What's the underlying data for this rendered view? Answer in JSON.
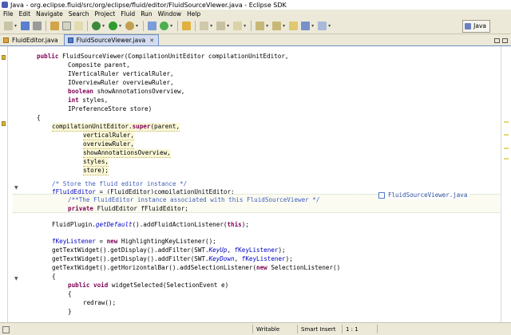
{
  "window": {
    "title": "Java - org.eclipse.fluid/src/org/eclipse/fluid/editor/FluidSourceViewer.java - Eclipse SDK"
  },
  "menu": [
    "File",
    "Edit",
    "Navigate",
    "Search",
    "Project",
    "Fluid",
    "Run",
    "Window",
    "Help"
  ],
  "toolbar": {
    "perspective_label": "Java",
    "icons": [
      "new-icon",
      "save-icon",
      "print-icon",
      "open-type-icon",
      "build-icon",
      "debug-icon",
      "run-icon",
      "new-class-icon",
      "search-icon",
      "next-annotation-icon",
      "prev-annotation-icon",
      "back-icon",
      "forward-icon"
    ]
  },
  "tabs": [
    {
      "label": "FluidEditor.java",
      "active": false
    },
    {
      "label": "FluidSourceViewer.java",
      "active": true
    }
  ],
  "code": {
    "l1": [
      "public",
      " FluidSourceViewer(CompilationUnitEditor compilationUnitEditor,"
    ],
    "l2": "Composite parent,",
    "l3": "IVerticalRuler verticalRuler,",
    "l4": "IOverviewRuler overviewRuler,",
    "l5": [
      "boolean",
      " showAnnotationsOverview,"
    ],
    "l6": [
      "int",
      " styles,"
    ],
    "l7": "IPreferenceStore store)",
    "l8": "{",
    "l9": [
      "compilationUnitEditor.",
      "super",
      "(parent,"
    ],
    "l10": "verticalRuler,",
    "l11": "overviewRuler,",
    "l12": "showAnnotationsOverview,",
    "l13": "styles,",
    "l14": "store);",
    "l15": "/* Store the fluid editor instance */",
    "l16": [
      "fFluidEditor",
      " = (FluidEditor)compilationUnitEditor;"
    ],
    "l17": "/**The FluidEditor instance associated with this FluidSourceViewer */",
    "l18": [
      "private",
      " FluidEditor fFluidEditor;"
    ],
    "l19": [
      "FluidPlugin.",
      "getDefault",
      "().addFluidActionListener(",
      "this",
      ");"
    ],
    "l20": [
      "fKeyListener",
      " = ",
      "new",
      " HighlightingKeyListener();"
    ],
    "l21": [
      "getTextWidget().getDisplay().addFilter(SWT.",
      "KeyUp",
      ", ",
      "fKeyListener",
      ");"
    ],
    "l22": [
      "getTextWidget().getDisplay().addFilter(SWT.",
      "KeyDown",
      ", ",
      "fKeyListener",
      ");"
    ],
    "l23": [
      "getTextWidget().getHorizontalBar().addSelectionListener(",
      "new",
      " SelectionListener()"
    ],
    "l24": "{",
    "l25": [
      "public",
      " ",
      "void",
      " widgetSelected(SelectionEvent e)"
    ],
    "l26": "{",
    "l27": "redraw();",
    "l28": "}"
  },
  "hover_hint": "FluidSourceViewer.java",
  "status": {
    "writable": "Writable",
    "insert_mode": "Smart Insert",
    "position": "1 : 1"
  }
}
